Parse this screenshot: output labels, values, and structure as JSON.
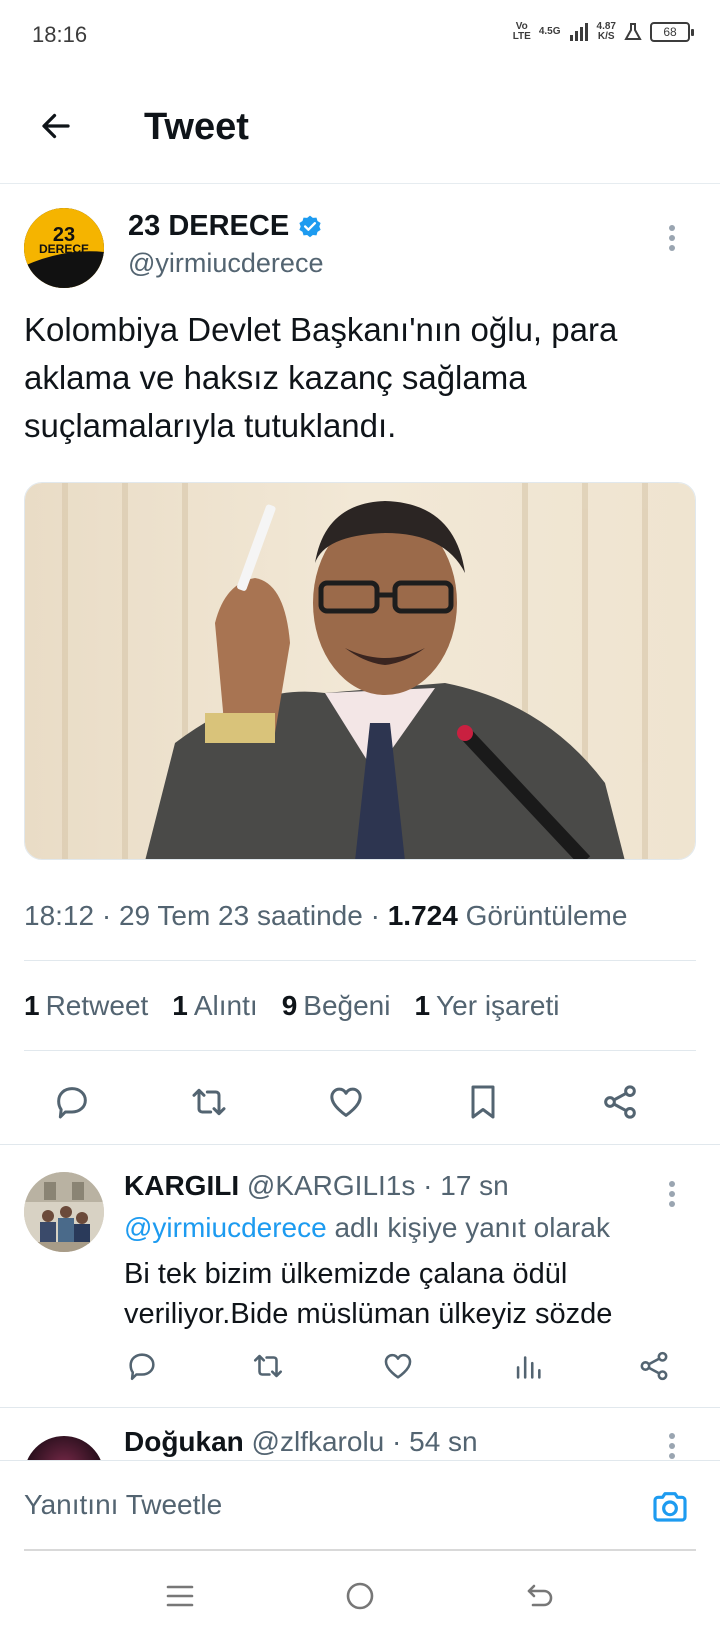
{
  "status_bar": {
    "time": "18:16",
    "network_top": "Vo",
    "network_bottom": "LTE",
    "signal_label": "4.5G",
    "speed_value": "4.87",
    "speed_unit": "K/S",
    "battery": "68"
  },
  "header": {
    "title": "Tweet"
  },
  "tweet": {
    "author_name": "23 DERECE",
    "author_handle": "@yirmiucderece",
    "avatar_text_top": "23",
    "avatar_text_bottom": "DERECE",
    "text": "Kolombiya Devlet Başkanı'nın oğlu, para aklama ve haksız kazanç sağlama suçlamalarıyla tutuklandı.",
    "meta_time": "18:12 · 29 Tem 23 saatinde · ",
    "views_count": "1.724",
    "views_label": " Görüntüleme",
    "stats": [
      {
        "count": "1",
        "label": "Retweet"
      },
      {
        "count": "1",
        "label": "Alıntı"
      },
      {
        "count": "9",
        "label": "Beğeni"
      },
      {
        "count": "1",
        "label": "Yer işareti"
      }
    ]
  },
  "reply": {
    "name": "KARGILI",
    "handle": " @KARGILI1s · 17 sn",
    "reply_to_mention": "@yirmiucderece",
    "reply_to_suffix": " adlı kişiye yanıt olarak",
    "text": "Bi tek bizim ülkemizde çalana ödül veriliyor.Bide müslüman ülkeyiz sözde"
  },
  "reply2": {
    "name": "Doğukan",
    "handle": " @zlfkarolu · 54 sn"
  },
  "compose": {
    "placeholder": "Yanıtını Tweetle"
  },
  "colors": {
    "accent": "#1d9bf0",
    "text_primary": "#0f1419",
    "text_secondary": "#536471",
    "icon": "#536471"
  }
}
